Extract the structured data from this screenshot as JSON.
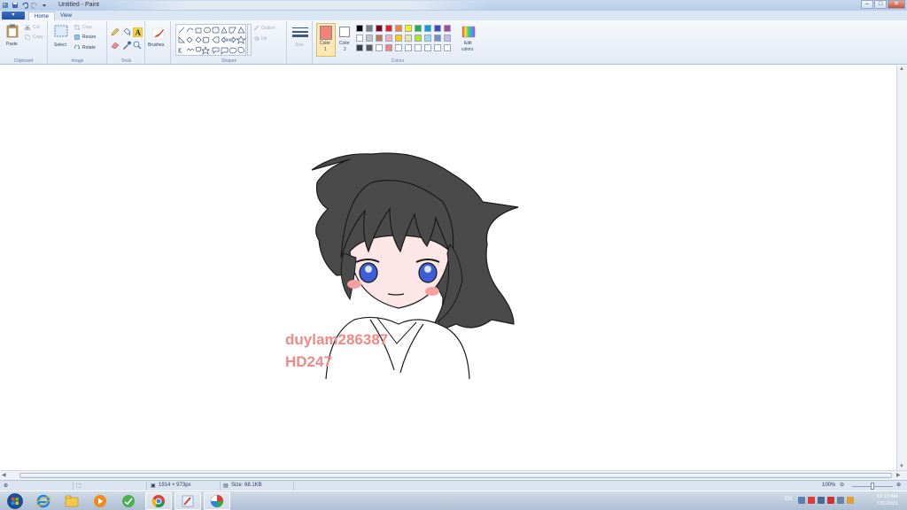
{
  "window": {
    "title": "Untitled - Paint"
  },
  "ribbon": {
    "app_menu_label": "▾",
    "tabs": [
      {
        "label": "Home"
      },
      {
        "label": "View"
      }
    ],
    "clipboard": {
      "paste": "Paste",
      "cut": "Cut",
      "copy": "Copy",
      "group": "Clipboard"
    },
    "image": {
      "select": "Select",
      "crop": "Crop",
      "resize": "Resize",
      "rotate": "Rotate",
      "group": "Image"
    },
    "tools": {
      "group": "Tools"
    },
    "brushes": {
      "label": "Brushes"
    },
    "shapes": {
      "outline": "Outline",
      "fill": "Fill",
      "group": "Shapes"
    },
    "size": {
      "label": "Size"
    },
    "colors": {
      "color1_label": "Color",
      "color1_index": "1",
      "color2_label": "Color",
      "color2_index": "2",
      "edit_colors_line1": "Edit",
      "edit_colors_line2": "colors",
      "group": "Colors",
      "color1": "#f4817a",
      "color2": "#ffffff",
      "palette_row1": [
        "#000000",
        "#7f7f7f",
        "#880015",
        "#ed1c24",
        "#ff7f27",
        "#fff200",
        "#22b14c",
        "#00a2e8",
        "#3f48cc",
        "#a349a4"
      ],
      "palette_row2": [
        "#ffffff",
        "#c3c3c3",
        "#b97a57",
        "#ffaec9",
        "#ffc90e",
        "#efe4b0",
        "#b5e61d",
        "#99d9ea",
        "#7092be",
        "#c8bfe7"
      ],
      "palette_row3": [
        "#3f3f3f",
        "#5a5a5a",
        "#ffffff",
        "#f4817a",
        "#ffffff",
        "#ffffff",
        "#ffffff",
        "#ffffff",
        "#ffffff",
        "#ffffff"
      ]
    }
  },
  "canvas": {
    "signature_line1": "duylam286387",
    "signature_line2": "HD247",
    "signature_color": "#f08a86"
  },
  "statusbar": {
    "dimensions": "1914 × 973px",
    "size": "Size: 68.1KB",
    "zoom": "100%"
  },
  "taskbar": {
    "language": "EN",
    "time": "10:10 AM",
    "date": "7/31/2021"
  }
}
